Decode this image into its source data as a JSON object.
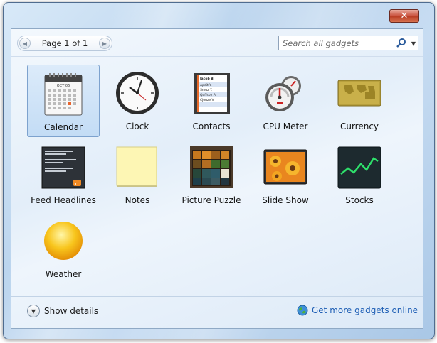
{
  "window": {
    "close_label": "✕"
  },
  "toolbar": {
    "page_label": "Page 1 of 1",
    "search_placeholder": "Search all gadgets"
  },
  "gadgets": [
    {
      "label": "Calendar",
      "selected": true
    },
    {
      "label": "Clock"
    },
    {
      "label": "Contacts"
    },
    {
      "label": "CPU Meter"
    },
    {
      "label": "Currency"
    },
    {
      "label": "Feed Headlines"
    },
    {
      "label": "Notes"
    },
    {
      "label": "Picture Puzzle"
    },
    {
      "label": "Slide Show"
    },
    {
      "label": "Stocks"
    },
    {
      "label": "Weather"
    }
  ],
  "calendar_icon": {
    "month": "OCT 06"
  },
  "contacts_icon": {
    "entries": [
      "Jacob B.",
      "Apdit Y.",
      "Smuz Y.",
      "Qaffspy A.",
      "Cjouze V."
    ]
  },
  "footer": {
    "show_details_label": "Show details",
    "get_more_label": "Get more gadgets online"
  },
  "colors": {
    "link": "#1f5fb5",
    "selection": "#c3dcf5"
  }
}
